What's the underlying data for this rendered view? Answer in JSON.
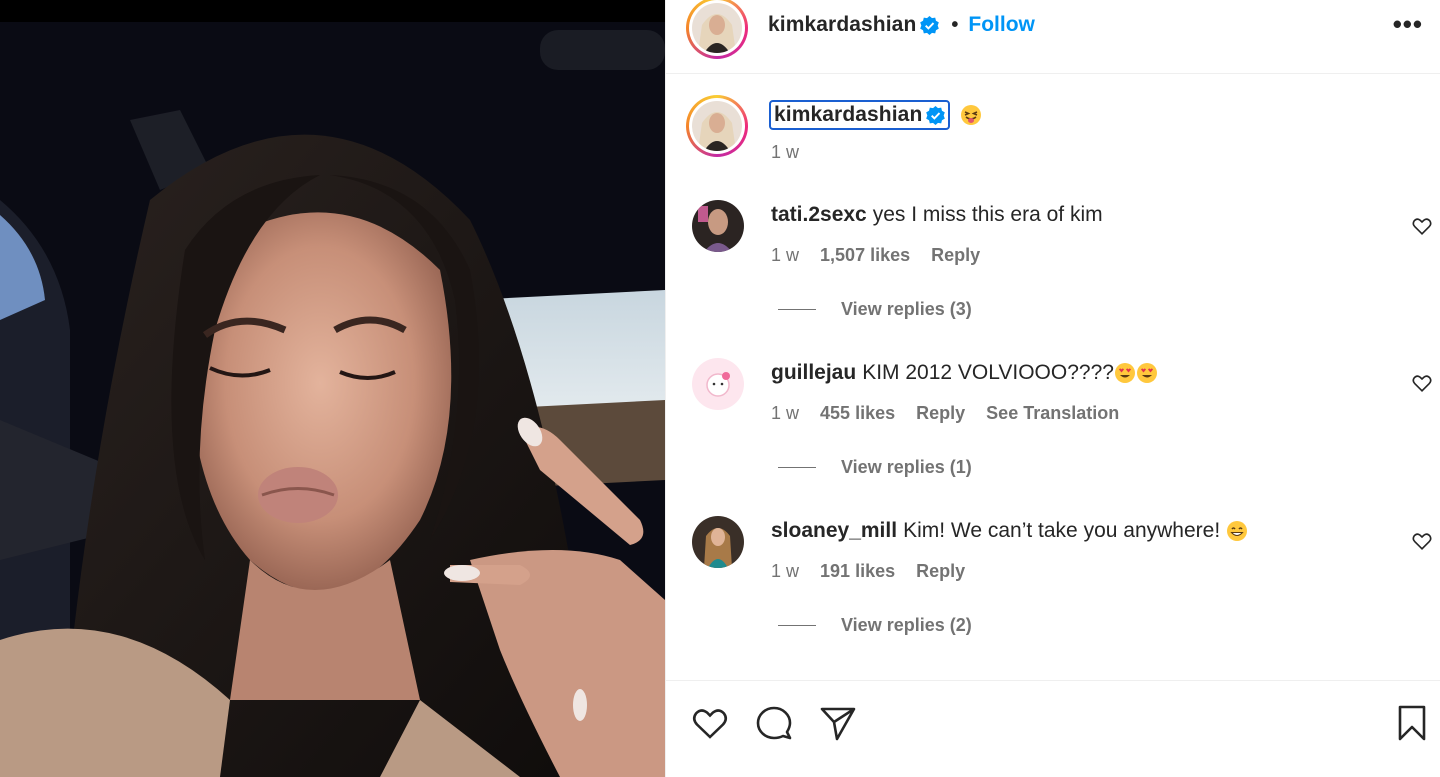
{
  "post": {
    "author": "kimkardashian",
    "follow_label": "Follow",
    "separator": "•",
    "more_label": "•••",
    "caption_time": "1 w"
  },
  "comments": [
    {
      "user": "tati.2sexc",
      "text": "yes I miss this era of kim",
      "time": "1 w",
      "likes": "1,507 likes",
      "reply": "Reply",
      "translation": "",
      "view_replies": "View replies (3)"
    },
    {
      "user": "guillejau",
      "text": "KIM 2012 VOLVIOOO????",
      "time": "1 w",
      "likes": "455 likes",
      "reply": "Reply",
      "translation": "See Translation",
      "view_replies": "View replies (1)"
    },
    {
      "user": "sloaney_mill",
      "text": "Kim! We can’t take you anywhere!",
      "time": "1 w",
      "likes": "191 likes",
      "reply": "Reply",
      "translation": "",
      "view_replies": "View replies (2)"
    }
  ],
  "icons": {
    "verified": "verified-badge-icon",
    "heart": "heart-icon",
    "comment": "comment-icon",
    "share": "share-icon",
    "save": "bookmark-icon"
  },
  "colors": {
    "accent": "#0095f6",
    "muted": "#737373",
    "text": "#262626"
  }
}
